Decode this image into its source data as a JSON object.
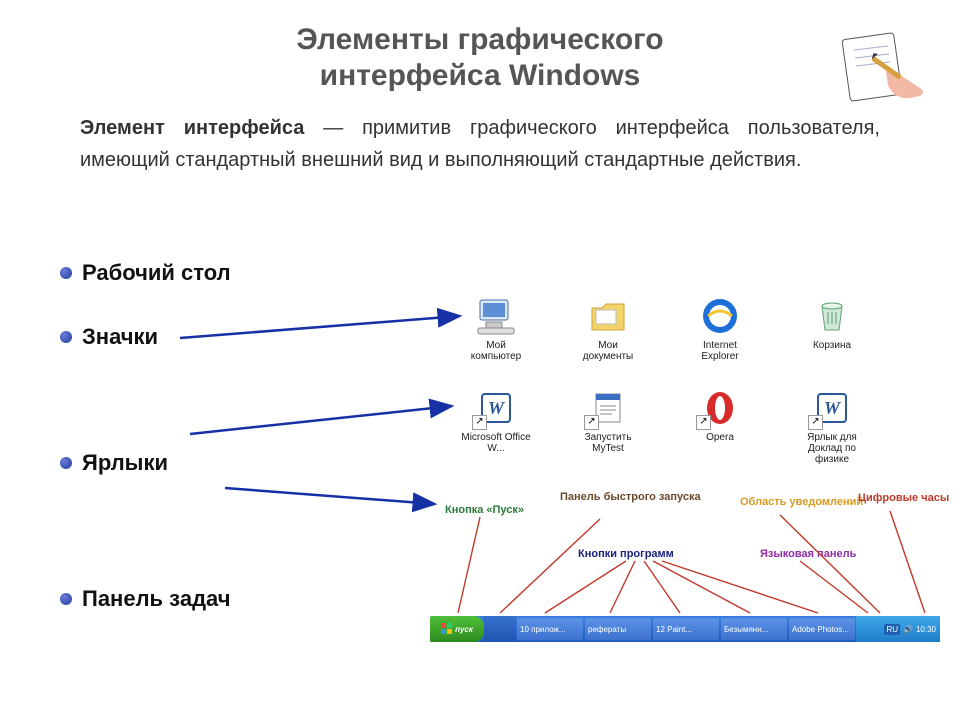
{
  "title_line1": "Элементы графического",
  "title_line2": "интерфейса Windows",
  "definition_bold": "Элемент интерфейса",
  "definition_rest": " — примитив графического интерфейса пользователя, имеющий стандартный внешний вид и выполняющий стандартные действия.",
  "bullets": {
    "desktop": "Рабочий стол",
    "icons": "Значки",
    "shortcuts": "Ярлыки",
    "taskbar": "Панель задач"
  },
  "desktop_icons_row1": [
    {
      "label": "Мой компьютер"
    },
    {
      "label": "Мои документы"
    },
    {
      "label": "Internet Explorer"
    },
    {
      "label": "Корзина"
    }
  ],
  "desktop_icons_row2": [
    {
      "label": "Microsoft Office W..."
    },
    {
      "label": "Запустить MyTest"
    },
    {
      "label": "Opera"
    },
    {
      "label": "Ярлык для Доклад по физике"
    }
  ],
  "taskbar_labels": {
    "quick": "Панель быстрого запуска",
    "start": "Кнопка «Пуск»",
    "notify": "Область уведомлений",
    "clock": "Цифровые часы",
    "programs": "Кнопки программ",
    "language": "Языковая панель"
  },
  "taskbar": {
    "start": "пуск",
    "buttons": [
      "10 прилож...",
      "рефераты",
      "12 Paint...",
      "Безымянн...",
      "Adobe Photos..."
    ],
    "lang": "RU",
    "clock": "10:30"
  }
}
